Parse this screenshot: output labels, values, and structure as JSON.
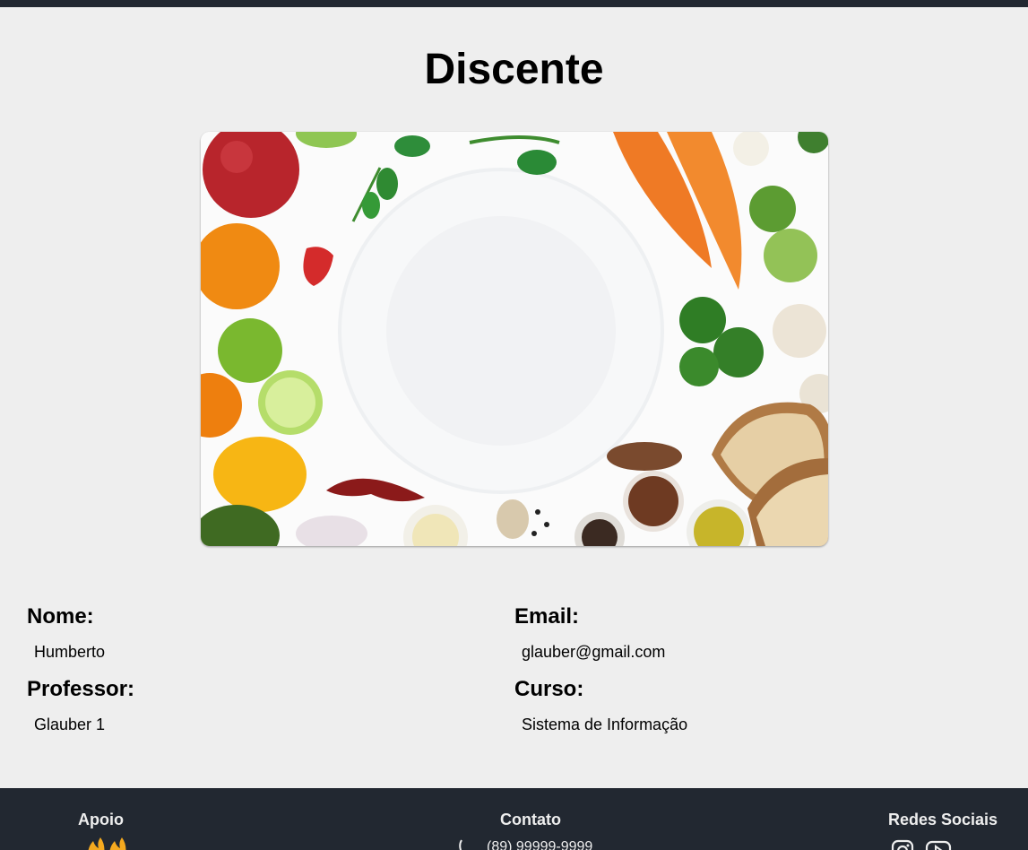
{
  "page": {
    "title": "Discente"
  },
  "student": {
    "nome_label": "Nome:",
    "nome_value": "Humberto",
    "email_label": "Email:",
    "email_value": "glauber@gmail.com",
    "professor_label": "Professor:",
    "professor_value": "Glauber 1",
    "curso_label": "Curso:",
    "curso_value": "Sistema de Informação"
  },
  "footer": {
    "apoio_heading": "Apoio",
    "contato_heading": "Contato",
    "phone": "(89) 99999-9999",
    "redes_heading": "Redes Sociais",
    "social_icons": [
      "instagram-icon",
      "youtube-icon"
    ]
  },
  "colors": {
    "background": "#eeeeee",
    "dark": "#222831"
  }
}
